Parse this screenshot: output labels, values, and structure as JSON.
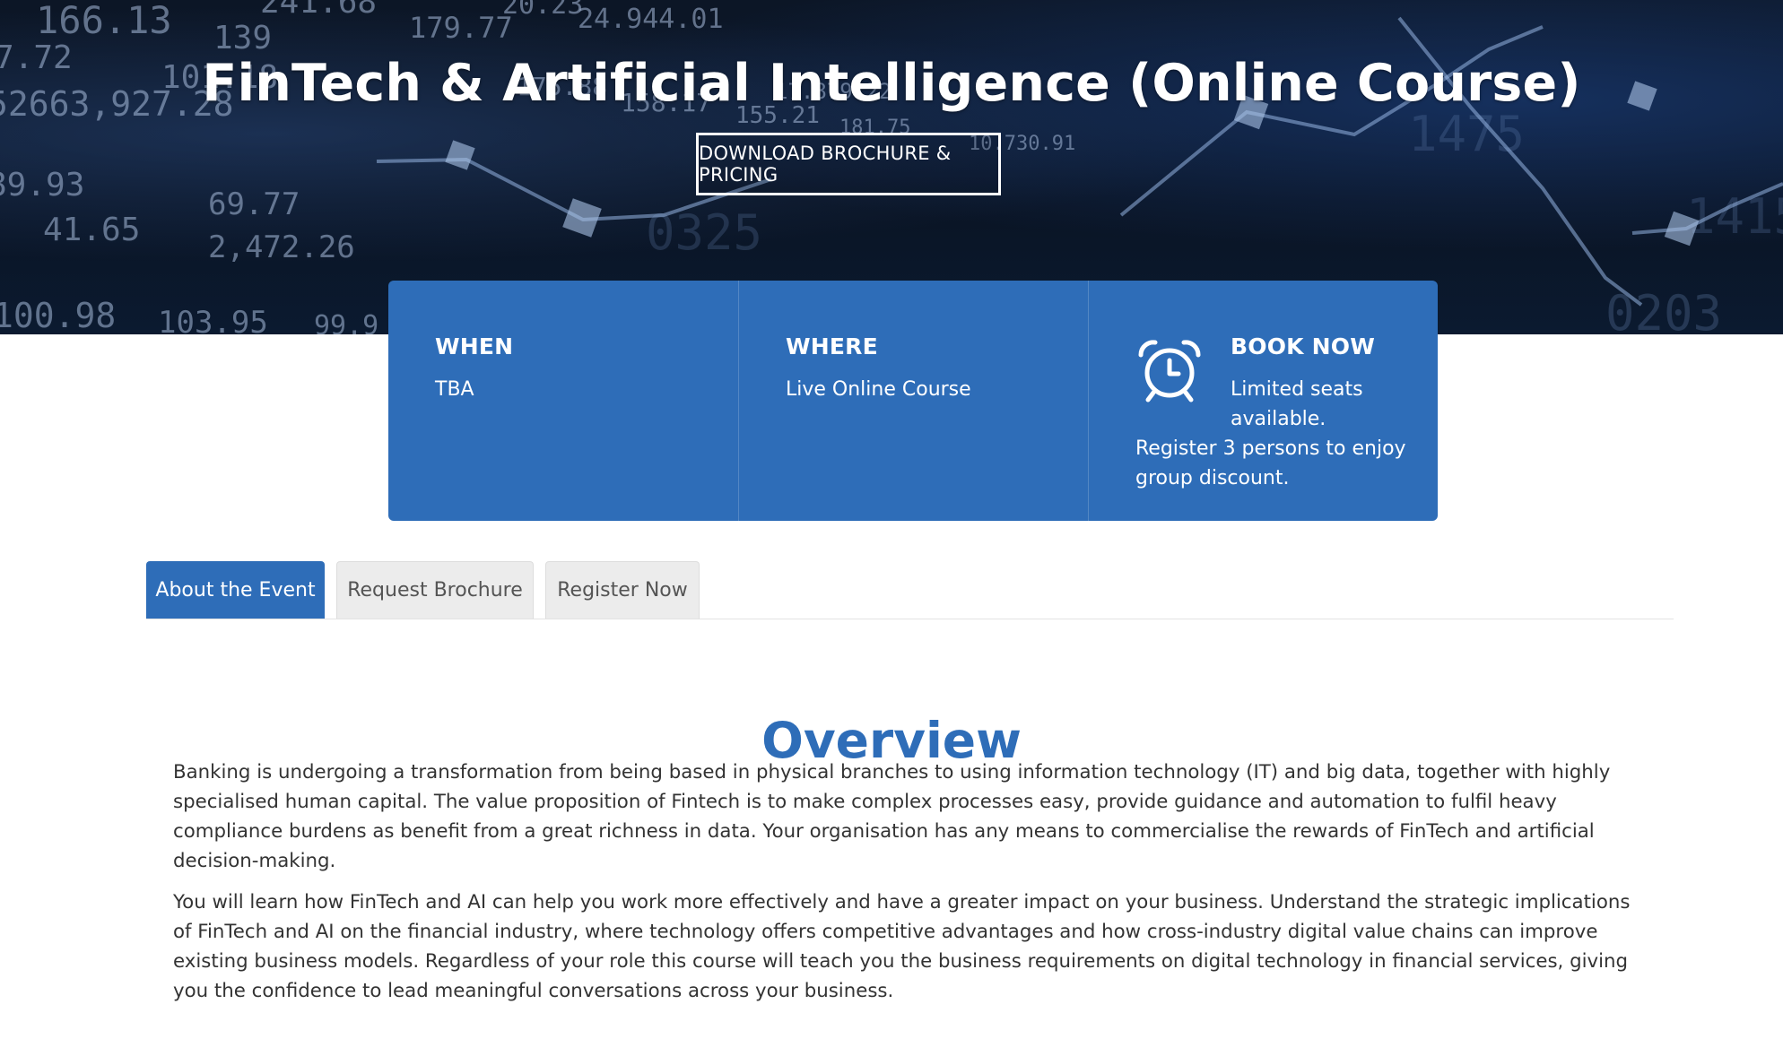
{
  "hero": {
    "title": "FinTech & Artificial Intelligence (Online Course)",
    "download_button": "DOWNLOAD BROCHURE & PRICING",
    "background_numbers": [
      "166.13",
      "139",
      "241.68",
      "179.77",
      "20.23",
      "24.944.01",
      "7.72",
      "101.18",
      "175.88",
      "17.879.22",
      "52663,927.28",
      "158.17",
      "155.21",
      "181.75",
      "89.93",
      "69.77",
      "41.65",
      "2,472.26",
      "100.98",
      "103.95",
      "99.9",
      "10.730.91",
      "0325",
      "0203",
      "1475",
      "1415"
    ]
  },
  "info": {
    "when": {
      "heading": "WHEN",
      "text": "TBA"
    },
    "where": {
      "heading": "WHERE",
      "text": "Live Online Course"
    },
    "book": {
      "heading": "BOOK NOW",
      "seats": "Limited seats available.",
      "discount": "Register 3 persons to enjoy group discount.",
      "icon": "alarm-clock-icon"
    }
  },
  "tabs": [
    {
      "label": "About the Event",
      "active": true
    },
    {
      "label": "Request Brochure",
      "active": false
    },
    {
      "label": "Register Now",
      "active": false
    }
  ],
  "content": {
    "title": "Overview",
    "paragraphs": [
      "Banking is undergoing a transformation from being based in physical branches to using information technology (IT) and big data, together with highly specialised human capital. The value proposition of Fintech is to make complex processes easy, provide guidance and automation to fulfil heavy compliance burdens as benefit from a great richness in data. Your organisation has any means to commercialise the rewards of FinTech and artificial decision-making.",
      "You will learn how FinTech and AI can help you work more effectively and have a greater impact on your business. Understand the strategic implications of FinTech and AI on the financial industry, where technology offers competitive advantages and how cross-industry digital value chains can improve existing business models. Regardless of your role this course will teach you the business requirements on digital technology in financial services, giving you the confidence to lead meaningful conversations across your business."
    ]
  },
  "colors": {
    "brand_blue": "#2e6db8",
    "hero_dark": "#0c1626",
    "tab_inactive_bg": "#ececec",
    "body_text": "#333333"
  }
}
